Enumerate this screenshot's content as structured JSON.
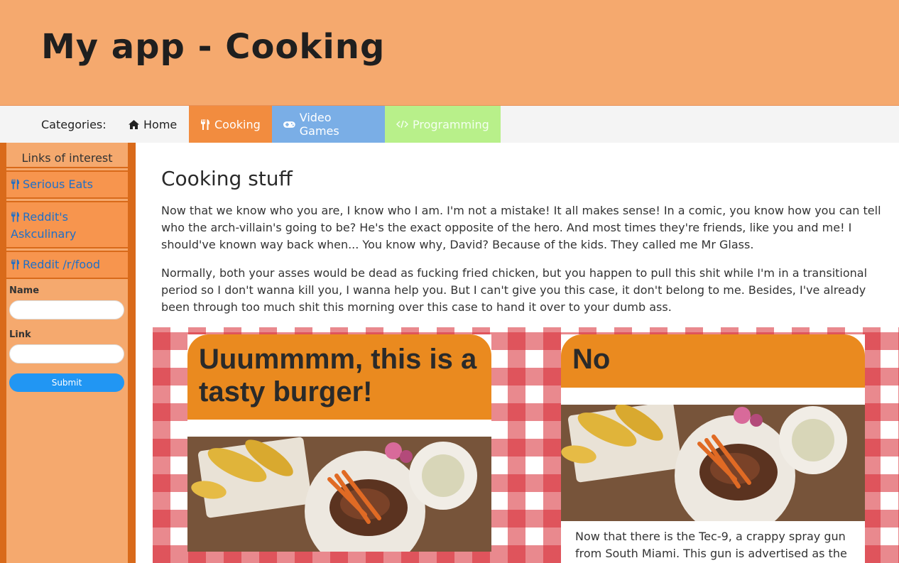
{
  "header": {
    "title": "My app - Cooking"
  },
  "nav": {
    "categories_label": "Categories:",
    "tabs": [
      {
        "label": "Home",
        "icon": "home-icon"
      },
      {
        "label": "Cooking",
        "icon": "utensils-icon"
      },
      {
        "label": "Video Games",
        "icon": "gamepad-icon"
      },
      {
        "label": "Programming",
        "icon": "code-icon"
      }
    ]
  },
  "sidebar": {
    "heading": "Links of interest",
    "links": [
      {
        "label": "Serious Eats",
        "icon": "utensils-icon"
      },
      {
        "label": "Reddit's Askculinary",
        "icon": "utensils-icon"
      },
      {
        "label": "Reddit /r/food",
        "icon": "utensils-icon"
      }
    ],
    "form": {
      "name_label": "Name",
      "name_value": "",
      "link_label": "Link",
      "link_value": "",
      "submit_label": "Submit"
    }
  },
  "main": {
    "title": "Cooking stuff",
    "paragraphs": [
      "Now that we know who you are, I know who I am. I'm not a mistake! It all makes sense! In a comic, you know how you can tell who the arch-villain's going to be? He's the exact opposite of the hero. And most times they're friends, like you and me! I should've known way back when... You know why, David? Because of the kids. They called me Mr Glass.",
      "Normally, both your asses would be dead as fucking fried chicken, but you happen to pull this shit while I'm in a transitional period so I don't wanna kill you, I wanna help you. But I can't give you this case, it don't belong to me. Besides, I've already been through too much shit this morning over this case to hand it over to your dumb ass."
    ],
    "cards": [
      {
        "title": "Uuummmm, this is a tasty burger!",
        "text": ""
      },
      {
        "title": "No",
        "text": "Now that there is the Tec-9, a crappy spray gun from South Miami. This gun is advertised as the"
      }
    ]
  },
  "colors": {
    "header_bg": "#f5a96e",
    "cooking_tab": "#f28c3f",
    "games_tab": "#7aaee6",
    "programming_tab": "#b8f08a",
    "sidebar_border": "#d96a1a",
    "card_title_bg": "#ea8a1f",
    "link_color": "#1e6fc8",
    "submit_bg": "#2196f3"
  }
}
